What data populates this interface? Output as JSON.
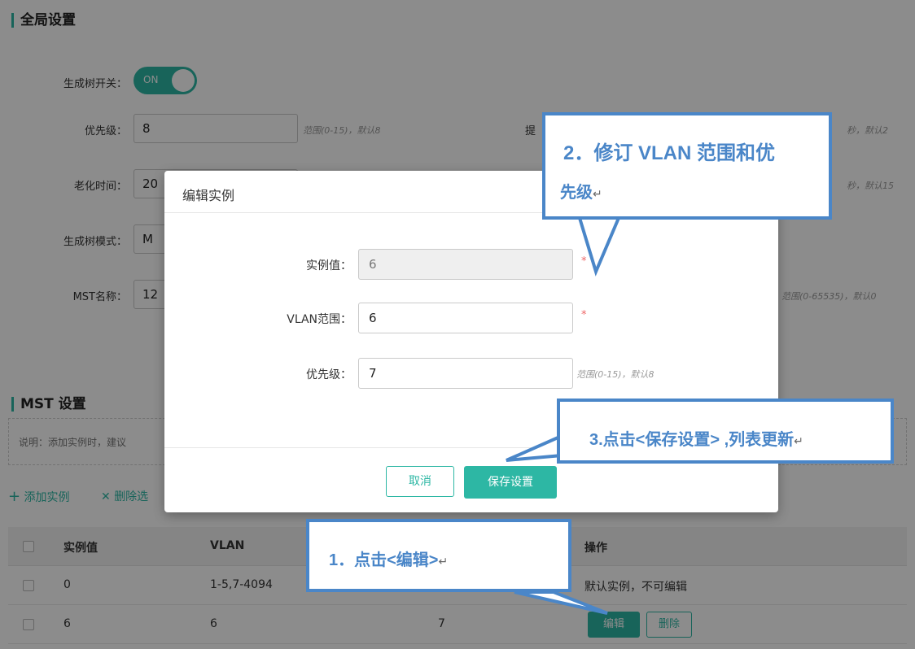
{
  "global": {
    "section_title": "全局设置",
    "stp_switch_label": "生成树开关：",
    "stp_switch_state": "ON",
    "priority_label": "优先级：",
    "priority_value": "8",
    "priority_hint": "范围(0-15)，默认8",
    "hello_label_partial": "提",
    "hello_hint_partial": "秒，默认2",
    "aging_label": "老化时间：",
    "aging_value_partial": "20",
    "aging_hint_partial": "秒，默认15",
    "mode_label": "生成树模式：",
    "mode_value_partial": "M",
    "mst_name_label": "MST名称：",
    "mst_name_value_partial": "12",
    "revision_hint_partial": "范围(0-65535)，默认0"
  },
  "mst": {
    "section_title": "MST 设置",
    "note_partial": "说明：添加实例时，建议",
    "add_instance": "添加实例",
    "delete_selected_partial": "删除选",
    "columns": [
      "实例值",
      "VLAN",
      "操作"
    ],
    "rows": [
      {
        "instance": "0",
        "vlan": "1-5,7-4094",
        "priority": "",
        "action_text": "默认实例，不可编辑"
      },
      {
        "instance": "6",
        "vlan": "6",
        "priority": "7",
        "edit": "编辑",
        "delete": "删除"
      }
    ]
  },
  "modal": {
    "title": "编辑实例",
    "instance_label": "实例值：",
    "instance_value": "6",
    "vlan_label": "VLAN范围：",
    "vlan_value": "6",
    "priority_label": "优先级：",
    "priority_value": "7",
    "priority_hint": "范围(0-15)，默认8",
    "required_mark": "*",
    "cancel": "取消",
    "save": "保存设置"
  },
  "callouts": {
    "c1": "1．点击<编辑>",
    "c2_line1": "2．修订 VLAN 范围和优",
    "c2_line2": "先级",
    "c3": "3.点击<保存设置> ,列表更新",
    "return_mark": "↵"
  },
  "colors": {
    "accent": "#2db7a4",
    "callout": "#4a86c8",
    "required": "#e66666"
  },
  "icons": {
    "plus": "+",
    "cross": "✕"
  }
}
